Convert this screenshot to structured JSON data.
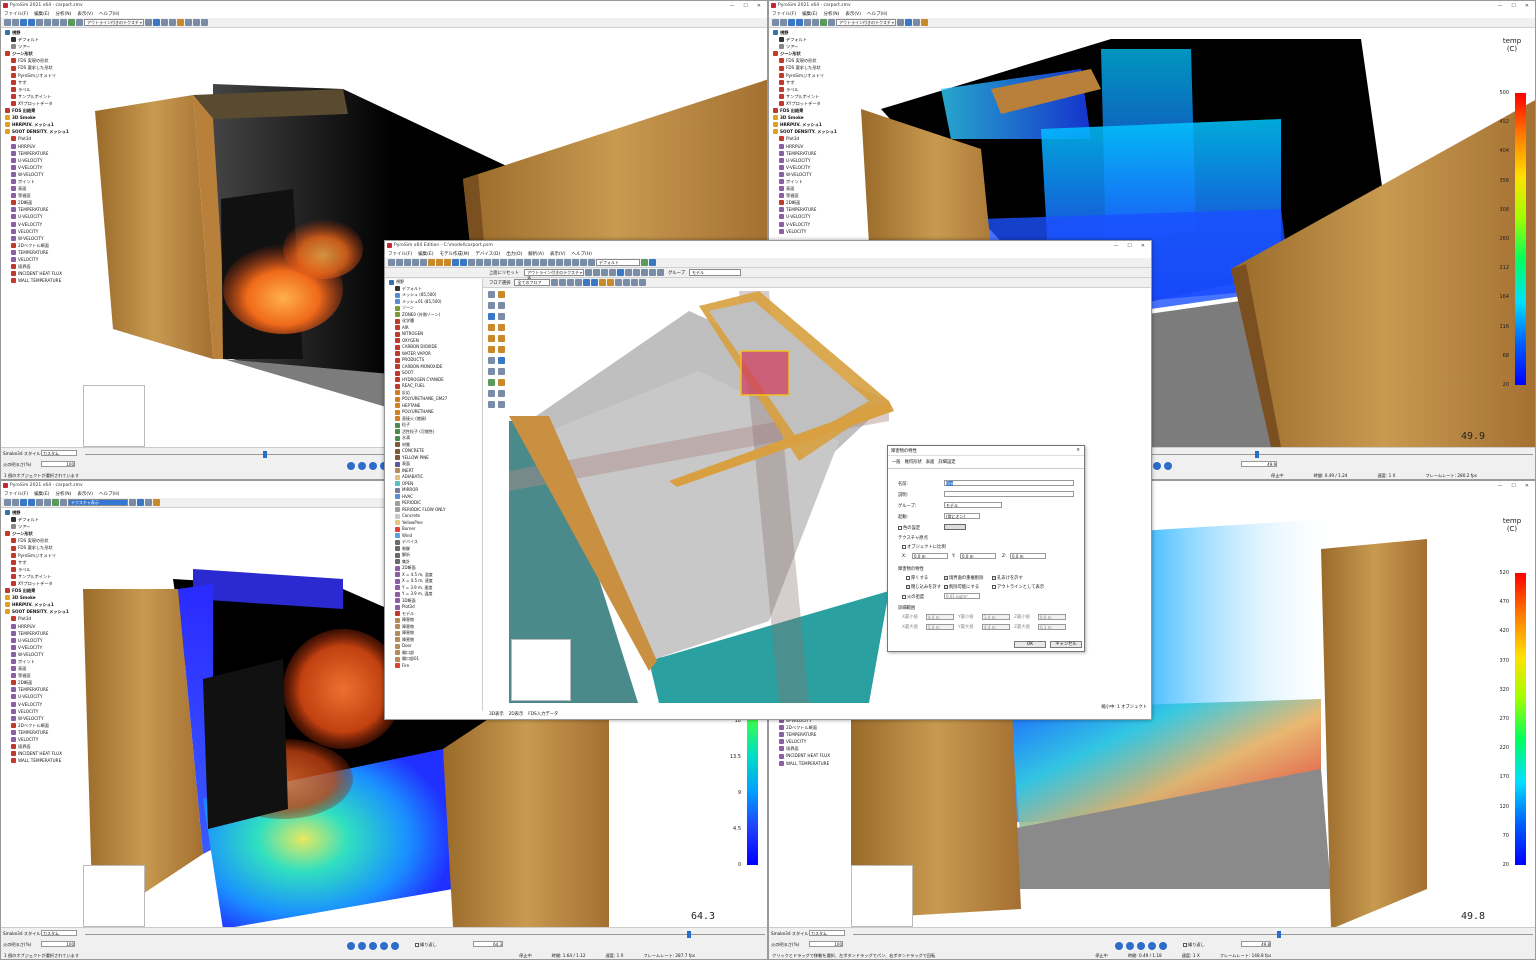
{
  "top_left": {
    "title": "PyroSim 2021 x64 - carport.smv",
    "menus": [
      "ファイル(F)",
      "編集(E)",
      "分析(N)",
      "表示(V)",
      "ヘルプ(H)"
    ],
    "view_combo": "アウトライン付きのテクスチャ",
    "tree": [
      {
        "label": "視野",
        "color": "#3a6fb0",
        "bold": true
      },
      {
        "label": "デフォルト",
        "color": "#333",
        "bold": false
      },
      {
        "label": "ツアー",
        "color": "#888",
        "bold": false
      },
      {
        "label": "ジーン形状",
        "color": "#c0392b",
        "bold": true
      },
      {
        "label": "FDS 実現の形状",
        "color": "#c0392b",
        "bold": false
      },
      {
        "label": "FDS 要求した形状",
        "color": "#c0392b",
        "bold": false
      },
      {
        "label": "PyroSimジオメトリ",
        "color": "#c0392b",
        "bold": false
      },
      {
        "label": "サポ",
        "color": "#c0392b",
        "bold": false
      },
      {
        "label": "ラベル",
        "color": "#c0392b",
        "bold": false
      },
      {
        "label": "サンプルポイント",
        "color": "#c0392b",
        "bold": false
      },
      {
        "label": "XYプロットデータ",
        "color": "#c0392b",
        "bold": false
      },
      {
        "label": "FDS 出結果",
        "color": "#c0392b",
        "bold": true
      },
      {
        "label": "3D Smoke",
        "color": "#e0a020",
        "bold": true
      },
      {
        "label": "HRRPUV. メッシュ1",
        "color": "#e0a020",
        "bold": true
      },
      {
        "label": "SOOT DENSITY. メッシュ1",
        "color": "#e0a020",
        "bold": true
      },
      {
        "label": "Plot3d",
        "color": "#c0392b",
        "bold": false
      },
      {
        "label": "HRRPUV",
        "color": "#8e5ea2",
        "bold": false
      },
      {
        "label": "TEMPERATURE",
        "color": "#8e5ea2",
        "bold": false
      },
      {
        "label": "U-VELOCITY",
        "color": "#8e5ea2",
        "bold": false
      },
      {
        "label": "V-VELOCITY",
        "color": "#8e5ea2",
        "bold": false
      },
      {
        "label": "W-VELOCITY",
        "color": "#8e5ea2",
        "bold": false
      },
      {
        "label": "ポイント",
        "color": "#8e5ea2",
        "bold": false
      },
      {
        "label": "表面",
        "color": "#8e5ea2",
        "bold": false
      },
      {
        "label": "等値面",
        "color": "#8e5ea2",
        "bold": false
      },
      {
        "label": "2D断面",
        "color": "#c0392b",
        "bold": false
      },
      {
        "label": "TEMPERATURE",
        "color": "#8e5ea2",
        "bold": false
      },
      {
        "label": "U-VELOCITY",
        "color": "#8e5ea2",
        "bold": false
      },
      {
        "label": "V-VELOCITY",
        "color": "#8e5ea2",
        "bold": false
      },
      {
        "label": "VELOCITY",
        "color": "#8e5ea2",
        "bold": false
      },
      {
        "label": "W-VELOCITY",
        "color": "#8e5ea2",
        "bold": false
      },
      {
        "label": "2Dベクトル断面",
        "color": "#c0392b",
        "bold": false
      },
      {
        "label": "TEMPERATURE",
        "color": "#8e5ea2",
        "bold": false
      },
      {
        "label": "VELOCITY",
        "color": "#8e5ea2",
        "bold": false
      },
      {
        "label": "境界面",
        "color": "#c0392b",
        "bold": false
      },
      {
        "label": "INCIDENT HEAT FLUX",
        "color": "#c0392b",
        "bold": false
      },
      {
        "label": "WALL TEMPERATURE",
        "color": "#c0392b",
        "bold": false
      }
    ],
    "smoke_style_label": "Smoke3d スタイル",
    "smoke_style_value": "カスタム",
    "opacity_label": "火の明るさ(%)",
    "opacity_value": "100",
    "status": "1 個のオブジェクトが選択されています"
  },
  "top_right": {
    "title": "PyroSim 2021 x64 - carport.smv",
    "menus": [
      "ファイル(F)",
      "編集(E)",
      "分析(N)",
      "表示(V)",
      "ヘルプ(H)"
    ],
    "view_combo": "アウトライン付きのテクスチャ",
    "legend_title": "temp",
    "legend_unit": "(C)",
    "legend_values": [
      "500",
      "452",
      "404",
      "356",
      "308",
      "260",
      "212",
      "164",
      "116",
      "68",
      "20"
    ],
    "time": "49.9",
    "time_field": "49.9",
    "status_left": "停止中",
    "status_frame": "時間: 0.49 / 1.24",
    "status_speed": "速度: 1 X",
    "status_fps": "フレームレート: 280.2 fps"
  },
  "bottom_left": {
    "title": "PyroSim 2021 x64 - carport.smv",
    "menus": [
      "ファイル(F)",
      "編集(E)",
      "分析(N)",
      "表示(V)",
      "ヘルプ(H)"
    ],
    "view_combo": "テクスチャ表示",
    "legend_values": [
      "18",
      "13.5",
      "9",
      "4.5",
      "0"
    ],
    "time": "64.3",
    "time_field": "64.3",
    "smoke_style_label": "Smoke3d スタイル",
    "smoke_style_value": "カスタム",
    "opacity_label": "火の明るさ(%)",
    "opacity_value": "100",
    "loop_label": "繰り返し",
    "status": "1 個のオブジェクトが選択されています",
    "status_left": "停止中",
    "status_frame": "時間: 1.64 / 1.12",
    "status_speed": "速度: 1 X",
    "status_fps": "フレームレート: 287.7 fps"
  },
  "bottom_right": {
    "legend_title": "temp",
    "legend_unit": "(C)",
    "legend_values": [
      "520",
      "470",
      "420",
      "370",
      "320",
      "270",
      "220",
      "170",
      "120",
      "70",
      "20"
    ],
    "time": "49.8",
    "time_field": "49.8",
    "smoke_style_label": "Smoke3d スタイル",
    "smoke_style_value": "カスタム",
    "opacity_label": "火の明るさ(%)",
    "opacity_value": "100",
    "loop_label": "繰り返し",
    "status": "クリックとドラッグで移動を選択、左ボタンドラッグでパン、右ボタンドラッグで回転",
    "status_left": "停止中",
    "status_frame": "時間: 0.49 / 1.18",
    "status_speed": "速度: 1 X",
    "status_fps": "フレームレート: 148.8 fps",
    "tree_tail": [
      "W-VELOCITY",
      "2Dベクトル断面",
      "TEMPERATURE",
      "VELOCITY",
      "境界面",
      "INCIDENT HEAT FLUX",
      "WALL TEMPERATURE"
    ]
  },
  "center": {
    "title": "PyroSim x64 Edition - C:\\model\\carport.psm",
    "menus": [
      "ファイル(F)",
      "編集(E)",
      "モデル作成(M)",
      "デバイス(D)",
      "出力(O)",
      "解析(A)",
      "表示(V)",
      "ヘルプ(H)"
    ],
    "toolbar_combo1": "デフォルト",
    "toolbar_combo2": "アウトライン付きのテクスチャ表",
    "group_label": "グループ",
    "group_value": "モデル",
    "floor_label": "フロア選択",
    "floor_value": "全てのフロア",
    "reset_label": "上面にリセット",
    "tree": [
      {
        "label": "視野",
        "color": "#3a6fb0"
      },
      {
        "label": "デフォルト",
        "color": "#333"
      },
      {
        "label": "メッシュ (85,500)",
        "color": "#5a8ad0"
      },
      {
        "label": "メッシュ01 (85,500)",
        "color": "#5a8ad0"
      },
      {
        "label": "ゾーン",
        "color": "#7a9a3a"
      },
      {
        "label": "ZONE0 (外側ゾーン)",
        "color": "#7a9a3a"
      },
      {
        "label": "化学種",
        "color": "#c0392b"
      },
      {
        "label": "AIR",
        "color": "#c0392b"
      },
      {
        "label": "NITROGEN",
        "color": "#c0392b"
      },
      {
        "label": "OXYGEN",
        "color": "#c0392b"
      },
      {
        "label": "CARBON DIOXIDE",
        "color": "#c0392b"
      },
      {
        "label": "WATER VAPOR",
        "color": "#c0392b"
      },
      {
        "label": "PRODUCTS",
        "color": "#c0392b"
      },
      {
        "label": "CARBON MONOXIDE",
        "color": "#c0392b"
      },
      {
        "label": "SOOT",
        "color": "#c0392b"
      },
      {
        "label": "HYDROGEN CYANIDE",
        "color": "#c0392b"
      },
      {
        "label": "REAC_FUEL",
        "color": "#c0392b"
      },
      {
        "label": "反応",
        "color": "#d08020"
      },
      {
        "label": "POLYURETHANE_GM27",
        "color": "#d08020"
      },
      {
        "label": "HEPTANE",
        "color": "#d08020"
      },
      {
        "label": "POLYURETHANE",
        "color": "#d08020"
      },
      {
        "label": "直接火 (燃焼)",
        "color": "#d08020"
      },
      {
        "label": "粒子",
        "color": "#4a8a4a"
      },
      {
        "label": "活性粒子 (可燃性)",
        "color": "#4a8a4a"
      },
      {
        "label": "水滴",
        "color": "#4a8a4a"
      },
      {
        "label": "材質",
        "color": "#7a5a3a"
      },
      {
        "label": "CONCRETE",
        "color": "#7a5a3a"
      },
      {
        "label": "YELLOW PINE",
        "color": "#7a5a3a"
      },
      {
        "label": "表面",
        "color": "#5a5a9a"
      },
      {
        "label": "INERT",
        "color": "#b48c5a"
      },
      {
        "label": "ADIABATIC",
        "color": "#e0c080"
      },
      {
        "label": "OPEN",
        "color": "#5ac0c0"
      },
      {
        "label": "MIRROR",
        "color": "#7a7a9a"
      },
      {
        "label": "HVAC",
        "color": "#5a8ad0"
      },
      {
        "label": "PERIODIC",
        "color": "#a0a0a0"
      },
      {
        "label": "PERIODIC FLOW ONLY",
        "color": "#a0a0a0"
      },
      {
        "label": "Concrete",
        "color": "#c8c8c8"
      },
      {
        "label": "YellowPine",
        "color": "#e8c880"
      },
      {
        "label": "Burner",
        "color": "#e04030"
      },
      {
        "label": "Wind",
        "color": "#5aa0e0"
      },
      {
        "label": "デバイス",
        "color": "#6a6a6a"
      },
      {
        "label": "制御",
        "color": "#6a6a6a"
      },
      {
        "label": "解析",
        "color": "#6a6a6a"
      },
      {
        "label": "集計",
        "color": "#6a6a6a"
      },
      {
        "label": "2D断面",
        "color": "#8e5ea2"
      },
      {
        "label": "X = 4.5 m, 温度",
        "color": "#8e5ea2"
      },
      {
        "label": "X = 4.5 m, 速度",
        "color": "#8e5ea2"
      },
      {
        "label": "Y = 3.9 m, 速度",
        "color": "#8e5ea2"
      },
      {
        "label": "Y = 3.9 m, 温度",
        "color": "#8e5ea2"
      },
      {
        "label": "3D断面",
        "color": "#8e5ea2"
      },
      {
        "label": "Plot3d",
        "color": "#8e5ea2"
      },
      {
        "label": "モデル",
        "color": "#c0392b"
      },
      {
        "label": "障害物",
        "color": "#b48c5a"
      },
      {
        "label": "障害物",
        "color": "#b48c5a"
      },
      {
        "label": "障害物",
        "color": "#b48c5a"
      },
      {
        "label": "障害物",
        "color": "#b48c5a"
      },
      {
        "label": "Door",
        "color": "#b48c5a"
      },
      {
        "label": "開口部",
        "color": "#b48c5a"
      },
      {
        "label": "開口部01",
        "color": "#b48c5a"
      },
      {
        "label": "Fire",
        "color": "#e04030"
      }
    ],
    "bottom_tabs": [
      "3D表示",
      "2D表示",
      "FDS入力データ"
    ],
    "status_right": "縮小中: 1 オブジェクト"
  },
  "dialog": {
    "title": "障害物の特性",
    "tabs": [
      "一般",
      "幾何形状",
      "表面",
      "詳細設定"
    ],
    "name_label": "名前:",
    "name_value": "Fire",
    "desc_label": "説明:",
    "desc_value": "",
    "group_label": "グループ:",
    "group_value": "モデル",
    "activation_label": "起動:",
    "activation_value": "(常にオン)",
    "color_label": "色の設定",
    "texture_section": "テクスチャ原点",
    "texture_check": "オブジェクトに比例",
    "tx_label": "X:",
    "tx_value": "0.0 m",
    "ty_label": "Y:",
    "ty_value": "0.0 m",
    "tz_label": "Z:",
    "tz_value": "0.0 m",
    "props_section": "障害物の特性",
    "props": [
      "厚くする",
      "境界面の重複削除",
      "孔あけを許す",
      "閉じ込みを許す",
      "削除可能にする",
      "アウトラインとして表示"
    ],
    "burn_label": "火の密度",
    "burn_value": "0.01 kg/m³",
    "bulk_section": "詳細範囲",
    "bulk_rows": [
      [
        "X最小値",
        "4.0 m",
        "Y最小値",
        "3.4 m",
        "Z最小値",
        "0.0 m"
      ],
      [
        "X最大値",
        "5.0 m",
        "Y最大値",
        "4.4 m",
        "Z最大値",
        "0.1 m"
      ]
    ],
    "ok": "OK",
    "cancel": "キャンセル"
  }
}
